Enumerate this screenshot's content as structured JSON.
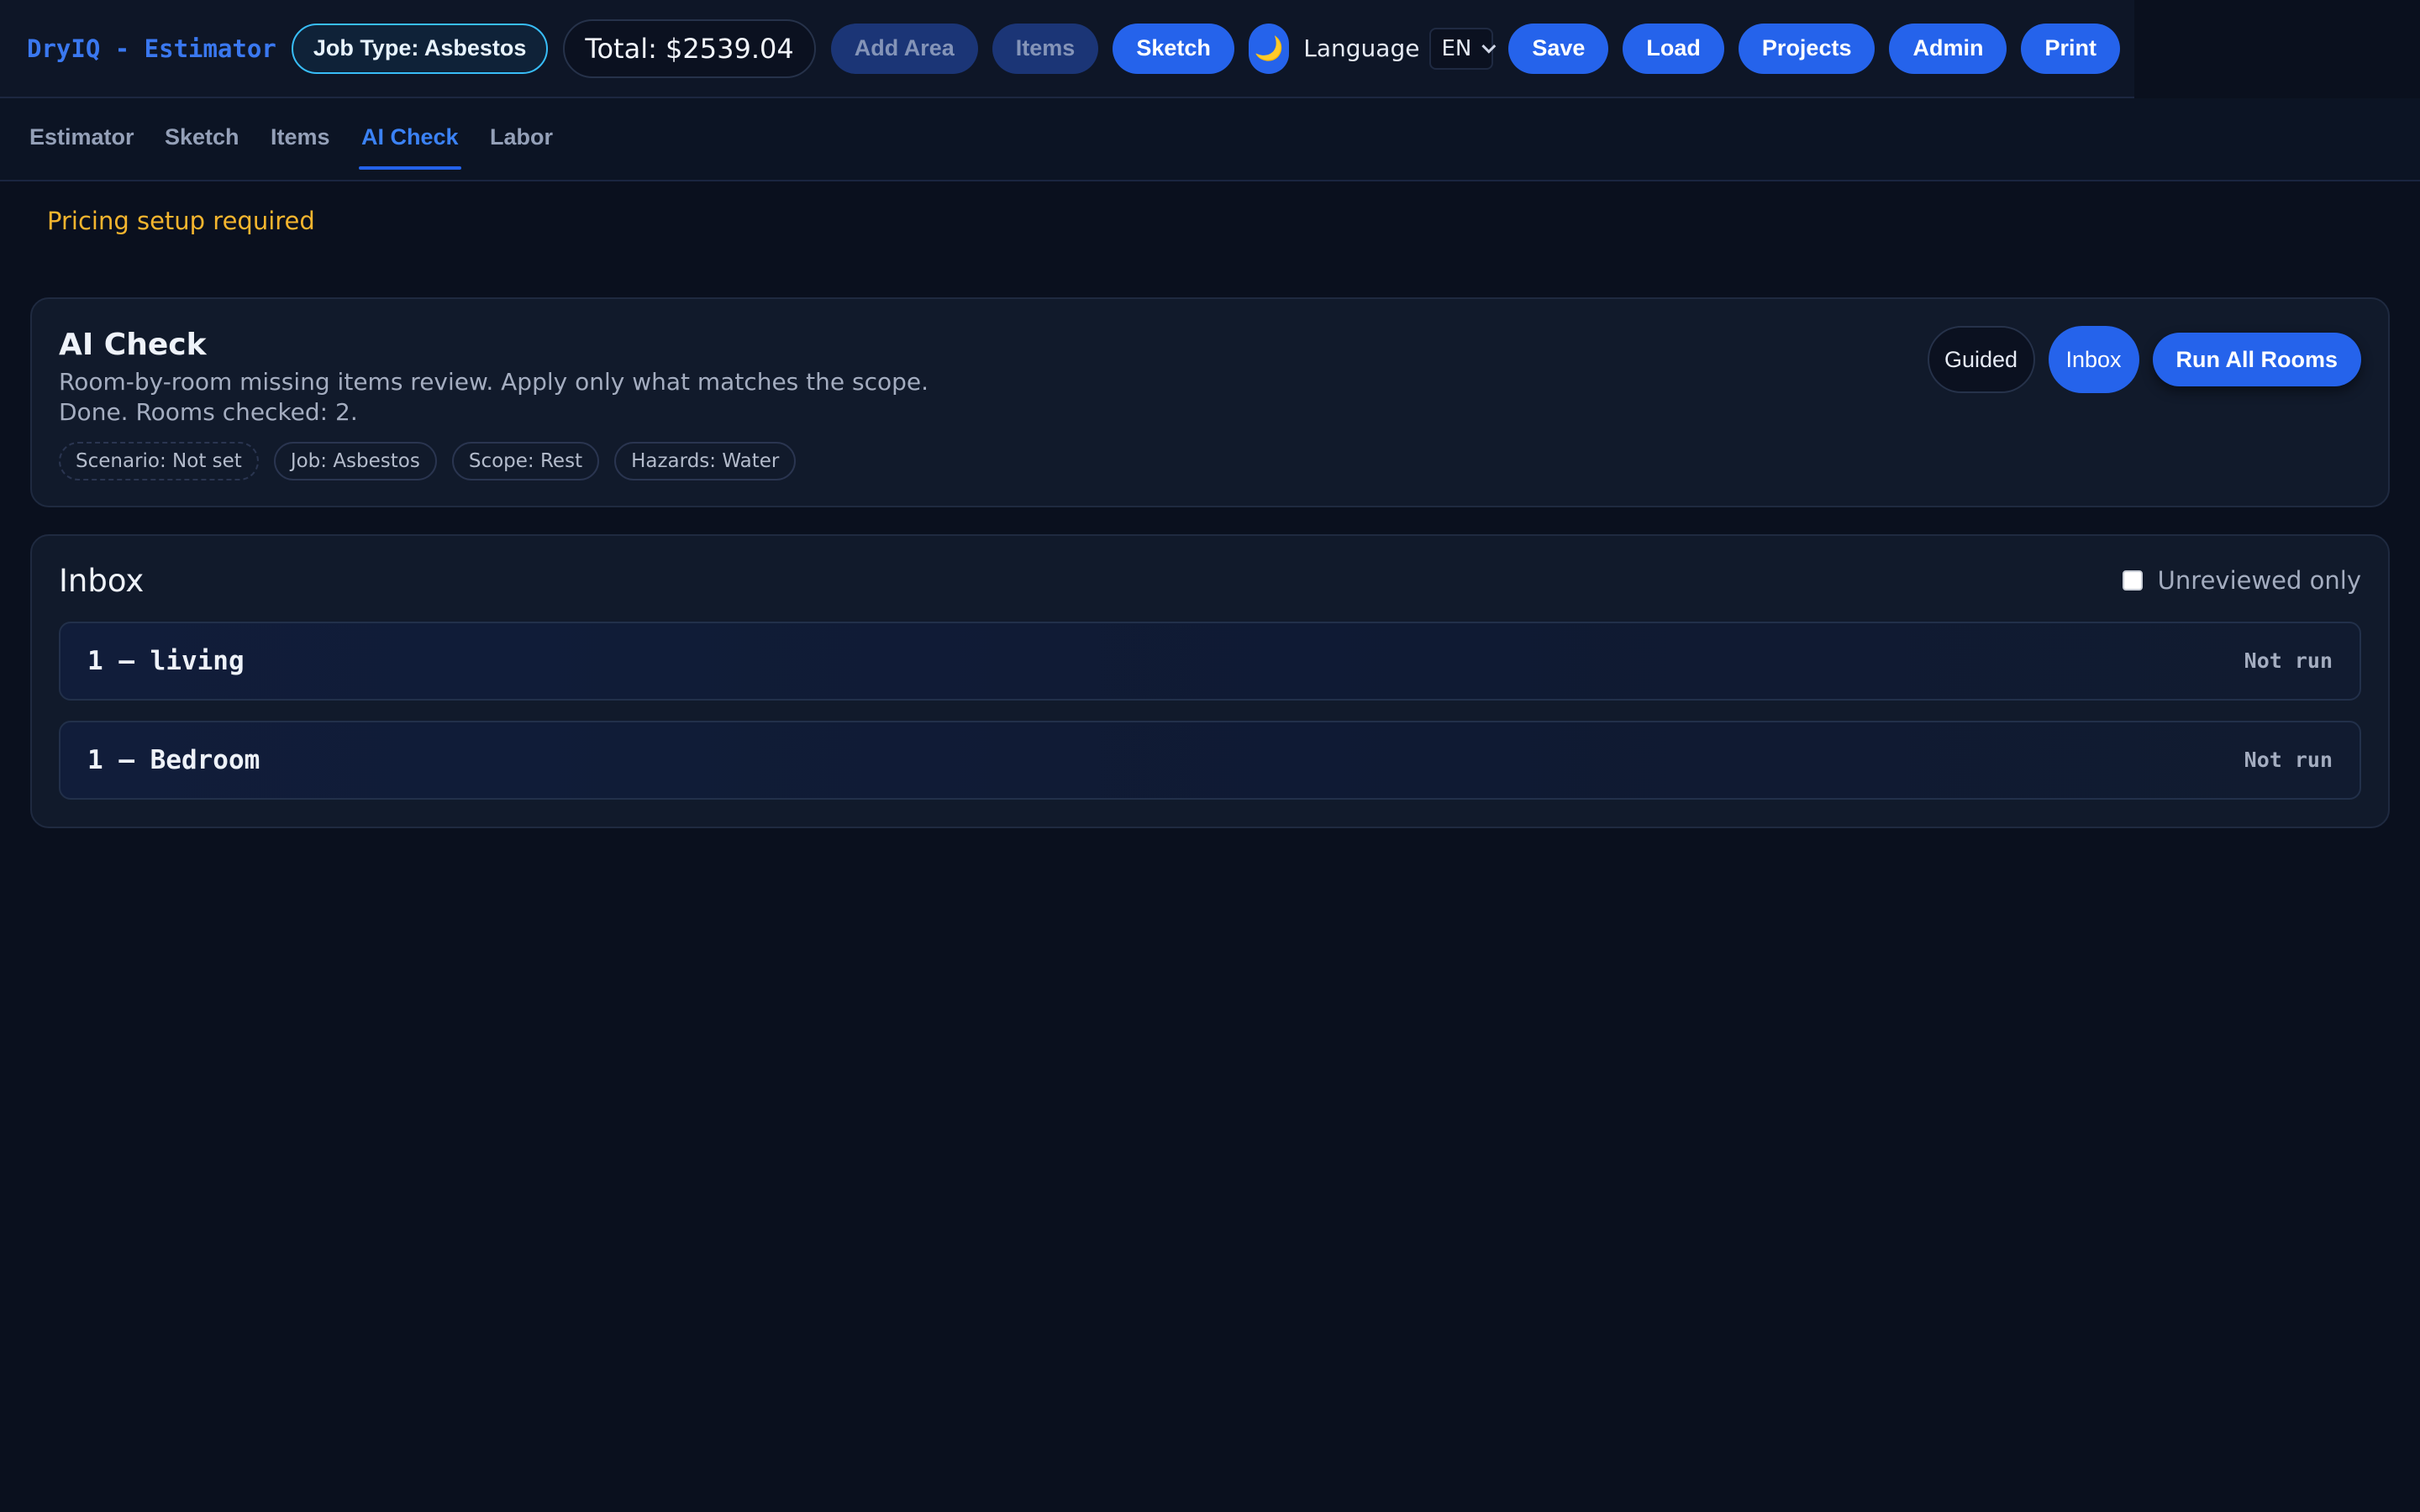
{
  "app": {
    "brand": "DryIQ - Estimator"
  },
  "topbar": {
    "job_type_label": "Job Type: Asbestos",
    "total_label": "Total: $2539.04",
    "add_area_label": "Add Area",
    "items_label": "Items",
    "sketch_label": "Sketch",
    "theme_icon": "moon-icon",
    "theme_glyph": "🌙",
    "language_label": "Language",
    "language_value": "EN",
    "save_label": "Save",
    "load_label": "Load",
    "projects_label": "Projects",
    "admin_label": "Admin",
    "print_label": "Print"
  },
  "tabs": [
    {
      "label": "Estimator",
      "active": false
    },
    {
      "label": "Sketch",
      "active": false
    },
    {
      "label": "Items",
      "active": false
    },
    {
      "label": "AI Check",
      "active": true
    },
    {
      "label": "Labor",
      "active": false
    }
  ],
  "warning": {
    "text": "Pricing setup required",
    "color": "#f5b52e"
  },
  "ai_check": {
    "title": "AI Check",
    "description": "Room-by-room missing items review. Apply only what matches the scope.",
    "status": "Done. Rooms checked: 2.",
    "pills": [
      {
        "label": "Scenario: Not set"
      },
      {
        "label": "Job: Asbestos"
      },
      {
        "label": "Scope: Rest"
      },
      {
        "label": "Hazards: Water"
      }
    ],
    "mode_guided_label": "Guided",
    "mode_inbox_label": "Inbox",
    "run_all_label": "Run All Rooms"
  },
  "inbox": {
    "title": "Inbox",
    "filter_label": "Unreviewed only",
    "filter_checked": false,
    "rooms": [
      {
        "name": "1 — living",
        "status": "Not run"
      },
      {
        "name": "1 — Bedroom",
        "status": "Not run"
      }
    ]
  },
  "colors": {
    "accent": "#2563eb",
    "background": "#0a101e",
    "job_type_border": "#38bdf8"
  }
}
